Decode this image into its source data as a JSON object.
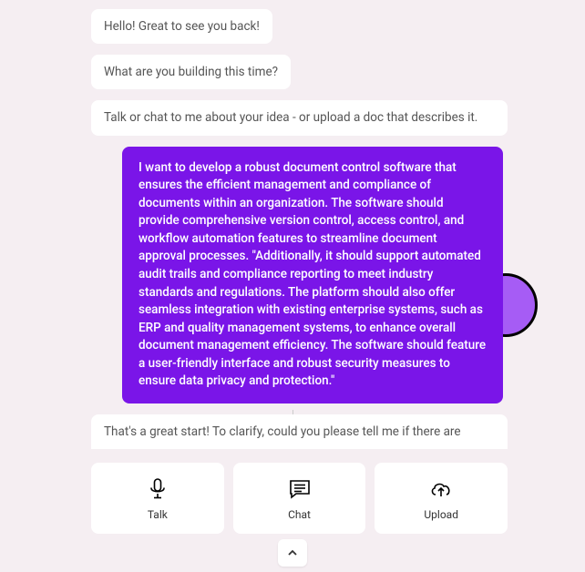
{
  "messages": {
    "bot1": "Hello! Great to see you back!",
    "bot2": "What are you building this time?",
    "bot3": "Talk or chat to me about your idea - or upload a doc that describes it.",
    "user1": "I want to develop a robust document control software that ensures the efficient management and compliance of documents within an organization. The software should provide comprehensive version control, access control, and workflow automation features to streamline document approval processes. \"Additionally, it should support automated audit trails and compliance reporting to meet industry standards and regulations. The platform should also offer seamless integration with existing enterprise systems, such as ERP and quality management systems, to enhance overall document management efficiency. The software should feature a user-friendly interface and robust security measures to ensure data privacy and protection.\"",
    "bot4": "That's a great start! To clarify, could you please tell me if there are"
  },
  "actions": {
    "talk": "Talk",
    "chat": "Chat",
    "upload": "Upload"
  }
}
